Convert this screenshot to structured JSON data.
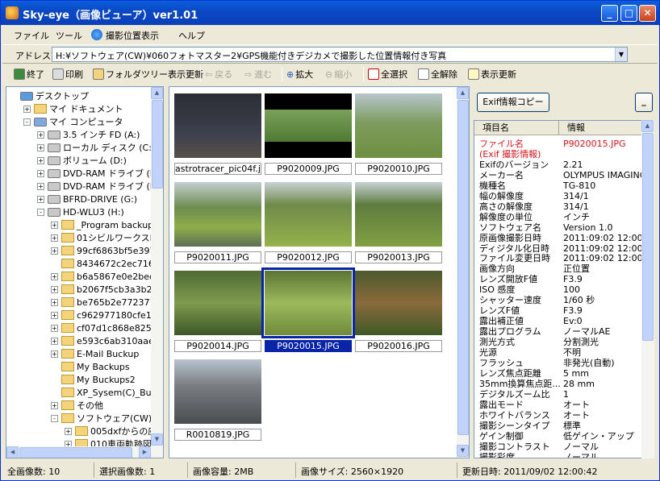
{
  "title": "Sky-eye（画像ビューア）ver1.01",
  "menu": [
    "ファイル",
    "ツール",
    "撮影位置表示",
    "ヘルプ"
  ],
  "address": {
    "label": "アドレス",
    "value": "H:¥ソフトウェア(CW)¥060フォトマスター2¥GPS機能付きデジカメで撮影した位置情報付き写真"
  },
  "toolbar": [
    {
      "label": "終了",
      "enabled": true
    },
    {
      "label": "印刷",
      "enabled": true
    },
    {
      "label": "フォルダツリー表示更新",
      "enabled": true
    },
    {
      "label": "戻る",
      "enabled": false
    },
    {
      "label": "進む",
      "enabled": false
    },
    {
      "label": "拡大",
      "enabled": true
    },
    {
      "label": "縮小",
      "enabled": false
    },
    {
      "label": "全選択",
      "enabled": true
    },
    {
      "label": "全解除",
      "enabled": true
    },
    {
      "label": "表示更新",
      "enabled": true
    }
  ],
  "tree": [
    "デスクトップ",
    "マイ ドキュメント",
    "マイ コンピュータ",
    "3.5 インチ FD (A:)",
    "ローカル ディスク (C:)",
    "ボリューム (D:)",
    "DVD-RAM ドライブ (E:)",
    "DVD-RAM ドライブ (F:)",
    "BFRD-DRIVE (G:)",
    "HD-WLU3 (H:)",
    "_Program backup f",
    "01シビルワークスHP",
    "99cf6863bf5e397fa",
    "8434672c2ec71608",
    "b6a5867e0e2bec91",
    "b2067f5cb3a3b278",
    "be765b2e772371ab",
    "c962977180cfe11a",
    "cf07d1c868e82597",
    "e593c6ab310aaea0",
    "E-Mail Buckup",
    "My Backups",
    "My Buckups2",
    "XP_Sysem(C)_Buck",
    "その他",
    "ソフトウェア(CW)",
    "005dxfからの座",
    "010車両軌跡図"
  ],
  "thumbnails": [
    {
      "label": "astrotracer_pic04f.jpg",
      "selected": false
    },
    {
      "label": "P9020009.JPG",
      "selected": false
    },
    {
      "label": "P9020010.JPG",
      "selected": false
    },
    {
      "label": "P9020011.JPG",
      "selected": false
    },
    {
      "label": "P9020012.JPG",
      "selected": false
    },
    {
      "label": "P9020013.JPG",
      "selected": false
    },
    {
      "label": "P9020014.JPG",
      "selected": false
    },
    {
      "label": "P9020015.JPG",
      "selected": true
    },
    {
      "label": "P9020016.JPG",
      "selected": false
    },
    {
      "label": "R0010819.JPG",
      "selected": false
    }
  ],
  "exif": {
    "copy_button": "Exif情報コピー",
    "min_button": "_",
    "col_name": "項目名",
    "col_info": "情報",
    "rows": [
      [
        "ファイル名",
        "P9020015.JPG"
      ],
      [
        "(Exif 撮影情報)",
        ""
      ],
      [
        "Exifのバージョン",
        "2.21"
      ],
      [
        "メーカー名",
        "OLYMPUS IMAGING"
      ],
      [
        "機種名",
        "TG-810"
      ],
      [
        "幅の解像度",
        "314/1"
      ],
      [
        "高さの解像度",
        "314/1"
      ],
      [
        "解像度の単位",
        "インチ"
      ],
      [
        "ソフトウェア名",
        "Version 1.0"
      ],
      [
        "原画像撮影日時",
        "2011:09:02 12:00:43"
      ],
      [
        "ディジタル化日時",
        "2011:09:02 12:00:43"
      ],
      [
        "ファイル変更日時",
        "2011:09:02 12:00:43"
      ],
      [
        "画像方向",
        "正位置"
      ],
      [
        "レンズ開放F値",
        "F3.9"
      ],
      [
        "ISO 感度",
        "100"
      ],
      [
        "シャッター速度",
        "1/60 秒"
      ],
      [
        "レンズF値",
        "F3.9"
      ],
      [
        "露出補正値",
        "Ev:0"
      ],
      [
        "露出プログラム",
        "ノーマルAE"
      ],
      [
        "測光方式",
        "分割測光"
      ],
      [
        "光源",
        "不明"
      ],
      [
        "フラッシュ",
        "非発光(自動)"
      ],
      [
        "レンズ焦点距離",
        "5 mm"
      ],
      [
        "35mm換算焦点距...",
        "28 mm"
      ],
      [
        "デジタルズーム比",
        "1"
      ],
      [
        "露出モード",
        "オート"
      ],
      [
        "ホワイトバランス",
        "オート"
      ],
      [
        "撮影シーンタイプ",
        "標準"
      ],
      [
        "ゲイン制御",
        "低ゲイン・アップ"
      ],
      [
        "撮影コントラスト",
        "ノーマル"
      ],
      [
        "撮影彩度",
        "ノーマル"
      ]
    ]
  },
  "status": [
    "全画像数: 10",
    "選択画像数: 1",
    "画像容量: 2MB",
    "画像サイズ: 2560×1920",
    "更新日時: 2011/09/02 12:00:42"
  ]
}
